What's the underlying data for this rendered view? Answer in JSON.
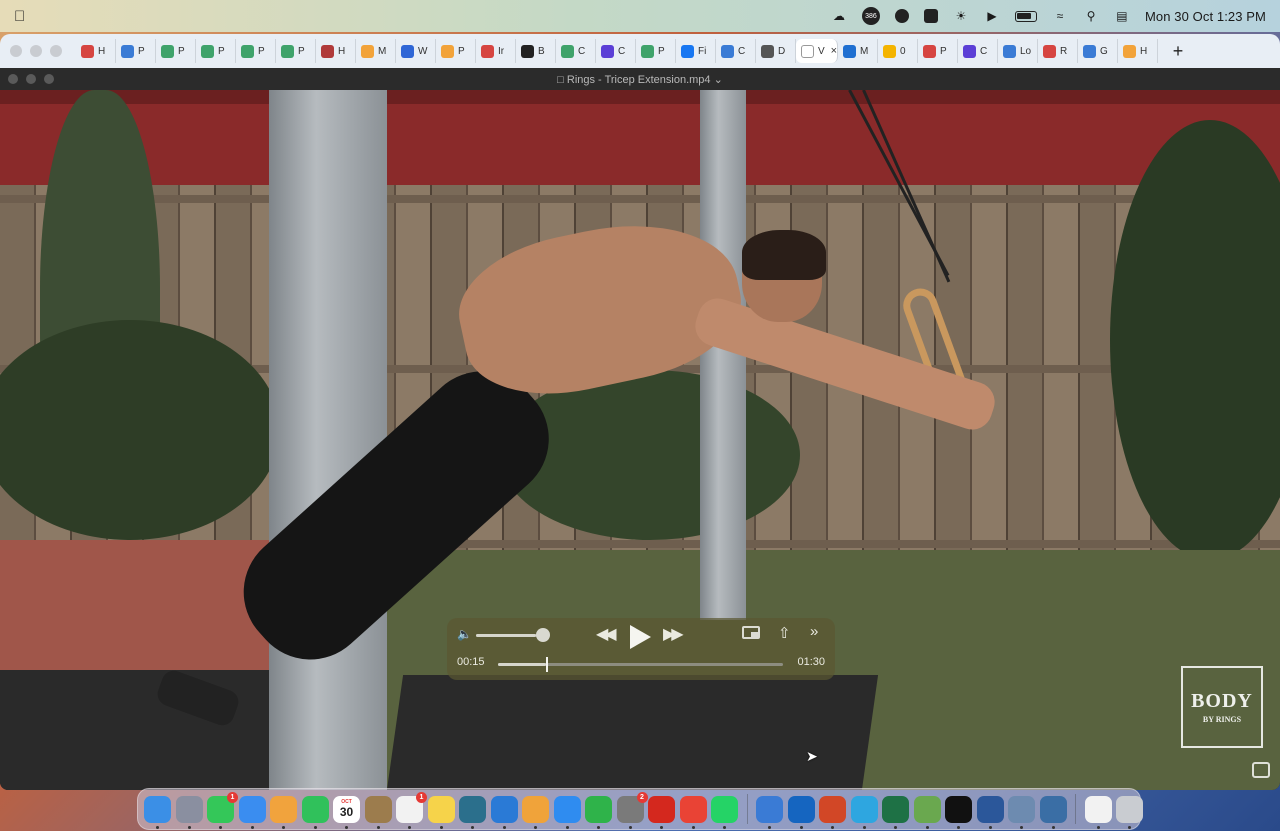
{
  "menubar": {
    "apple_icon": "apple-icon",
    "status_icons": [
      "cloud-icon",
      "counter-icon",
      "app-icon",
      "app2-icon",
      "brightness-icon",
      "play-circle-icon",
      "battery-icon",
      "wifi-icon",
      "search-icon",
      "control-center-icon"
    ],
    "counter_badge": "386",
    "clock": "Mon 30 Oct  1:23 PM"
  },
  "browser": {
    "tabs": [
      {
        "label": "H",
        "color": "#d64541"
      },
      {
        "label": "P",
        "color": "#3a7bd5"
      },
      {
        "label": "P",
        "color": "#3fa36b"
      },
      {
        "label": "P",
        "color": "#3fa36b"
      },
      {
        "label": "P",
        "color": "#3fa36b"
      },
      {
        "label": "P",
        "color": "#3fa36b"
      },
      {
        "label": "H",
        "color": "#b03a3a"
      },
      {
        "label": "M",
        "color": "#f2a33a"
      },
      {
        "label": "W",
        "color": "#2f66d6"
      },
      {
        "label": "P",
        "color": "#f2a33a"
      },
      {
        "label": "Ir",
        "color": "#d64541"
      },
      {
        "label": "B",
        "color": "#222222"
      },
      {
        "label": "C",
        "color": "#3fa36b"
      },
      {
        "label": "C",
        "color": "#5b3fd6"
      },
      {
        "label": "P",
        "color": "#3fa36b"
      },
      {
        "label": "Fi",
        "color": "#1877f2"
      },
      {
        "label": "C",
        "color": "#3a7bd5"
      },
      {
        "label": "D",
        "color": "#555555"
      },
      {
        "label": "V",
        "color": "#ffffff",
        "active": true
      },
      {
        "label": "M",
        "color": "#1f6fd1"
      },
      {
        "label": "0",
        "color": "#f4b400"
      },
      {
        "label": "P",
        "color": "#d64541"
      },
      {
        "label": "C",
        "color": "#5b3fd6"
      },
      {
        "label": "Lo",
        "color": "#3a7bd5"
      },
      {
        "label": "R",
        "color": "#d64541"
      },
      {
        "label": "G",
        "color": "#3a7bd5"
      },
      {
        "label": "H",
        "color": "#f2a33a"
      }
    ],
    "new_tab": "+"
  },
  "player": {
    "title": "Rings - Tricep Extension.mp4",
    "title_chevron": "⌄",
    "current_time": "00:15",
    "duration": "01:30",
    "progress": 0.167,
    "volume": 0.9,
    "watermark_line1": "BODY",
    "watermark_line2": "BY RINGS"
  },
  "dock": {
    "apps": [
      {
        "name": "finder",
        "color": "#3b8fe6"
      },
      {
        "name": "launchpad",
        "color": "#8a8fa0"
      },
      {
        "name": "messages",
        "color": "#34c759",
        "badge": "1"
      },
      {
        "name": "mail",
        "color": "#3a8df0"
      },
      {
        "name": "photos",
        "color": "#f1a33d"
      },
      {
        "name": "facetime",
        "color": "#30c15b"
      },
      {
        "name": "calendar",
        "month": "OCT",
        "day": "30"
      },
      {
        "name": "notes-folder",
        "color": "#9c7c4d"
      },
      {
        "name": "reminders",
        "color": "#f2f2f2",
        "badge": "1"
      },
      {
        "name": "notes",
        "color": "#f6d34a"
      },
      {
        "name": "stocks",
        "color": "#2b6f8c"
      },
      {
        "name": "keynote",
        "color": "#2a7ad6"
      },
      {
        "name": "pages",
        "color": "#f0a33a"
      },
      {
        "name": "app-store",
        "color": "#2f8cf0"
      },
      {
        "name": "numbers",
        "color": "#2fb34a"
      },
      {
        "name": "system-settings",
        "color": "#7a7a7a",
        "badge": "2"
      },
      {
        "name": "acrobat",
        "color": "#d4281e"
      },
      {
        "name": "chrome",
        "color": "#e94335"
      },
      {
        "name": "whatsapp",
        "color": "#25d366"
      },
      {
        "name": "downloads",
        "color": "#3a7bd5"
      },
      {
        "name": "outlook",
        "color": "#1565c0"
      },
      {
        "name": "powerpoint",
        "color": "#d24726"
      },
      {
        "name": "telegram",
        "color": "#2ea6e0"
      },
      {
        "name": "excel",
        "color": "#1e7145"
      },
      {
        "name": "pineapple-app",
        "color": "#6aa84f"
      },
      {
        "name": "capcut",
        "color": "#111111"
      },
      {
        "name": "word",
        "color": "#2b579a"
      },
      {
        "name": "preview",
        "color": "#6d8bb0"
      },
      {
        "name": "quicktime",
        "color": "#3a6ea5"
      },
      {
        "name": "document",
        "color": "#f2f2f2"
      },
      {
        "name": "trash",
        "color": "#c9ccd1"
      }
    ]
  }
}
